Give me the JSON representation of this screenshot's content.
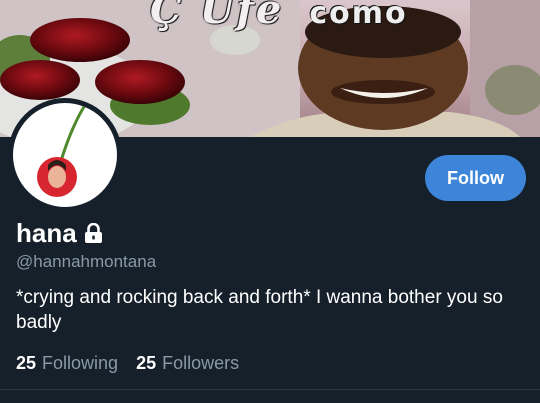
{
  "banner": {
    "text_main": "Ç Ufe",
    "text_sub": "como"
  },
  "profile": {
    "display_name": "hana",
    "handle": "@hannahmontana",
    "bio": "*crying and rocking back and forth* I wanna bother you so badly",
    "locked_icon": "lock-icon"
  },
  "follow_button": {
    "label": "Follow"
  },
  "stats": {
    "following_count": "25",
    "following_label": "Following",
    "followers_count": "25",
    "followers_label": "Followers"
  },
  "colors": {
    "background": "#15202b",
    "accent": "#3d85d8",
    "secondary_text": "#8899a6"
  }
}
